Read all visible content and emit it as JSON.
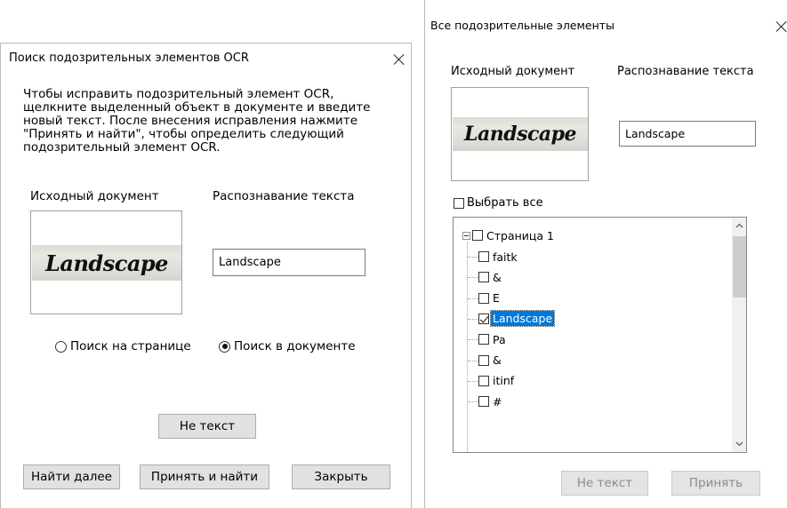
{
  "dialog1": {
    "title": "Поиск подозрительных элементов OCR",
    "instruction": "Чтобы исправить подозрительный элемент OCR,\nщелкните выделенный объект в документе и введите\nновый текст. После внесения исправления нажмите\n\"Принять и найти\", чтобы определить следующий\nподозрительный элемент OCR.",
    "source_label": "Исходный документ",
    "recognized_label": "Распознавание текста",
    "source_word": "Landscape",
    "recognized_value": "Landscape",
    "radio_page": "Поиск на странице",
    "radio_document": "Поиск в документе",
    "radio_selected": "document",
    "not_text_button": "Не текст",
    "find_next_button": "Найти далее",
    "accept_find_button": "Принять и найти",
    "close_button": "Закрыть"
  },
  "dialog2": {
    "title": "Все подозрительные элементы",
    "source_label": "Исходный документ",
    "recognized_label": "Распознавание текста",
    "source_word": "Landscape",
    "recognized_value": "Landscape",
    "select_all": "Выбрать все",
    "tree": {
      "root": "Страница 1",
      "items": [
        {
          "label": "faitk",
          "checked": false
        },
        {
          "label": "&",
          "checked": false
        },
        {
          "label": "E",
          "checked": false
        },
        {
          "label": "Landscape",
          "checked": true,
          "selected": true
        },
        {
          "label": "Pa",
          "checked": false
        },
        {
          "label": "&",
          "checked": false
        },
        {
          "label": "itinf",
          "checked": false
        },
        {
          "label": "#",
          "checked": false
        }
      ]
    },
    "not_text_button": "Не текст",
    "accept_button": "Принять"
  },
  "icons": {
    "close": "close-icon",
    "expander": "tree-collapse-icon",
    "scroll_up": "chevron-up-icon",
    "scroll_down": "chevron-down-icon"
  },
  "colors": {
    "selection": "#0078d7",
    "button_face": "#e1e1e1",
    "disabled_text": "#8a8a8a"
  }
}
